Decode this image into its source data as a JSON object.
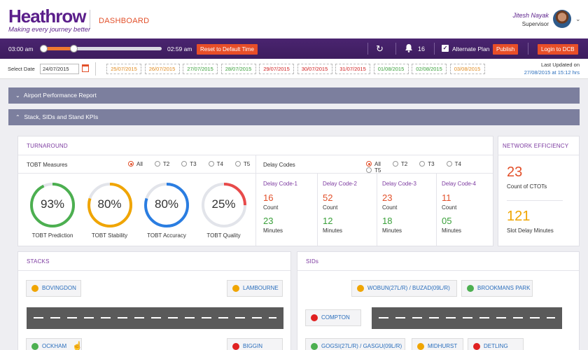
{
  "header": {
    "logo": "Heathrow",
    "tagline": "Making every journey better",
    "section": "DASHBOARD",
    "user_name": "Jitesh Nayak",
    "user_role": "Supervisor"
  },
  "timebar": {
    "start": "03:00 am",
    "end": "02:59 am",
    "reset_label": "Reset to Default Time",
    "notification_count": "16",
    "alternate_plan_label": "Alternate Plan",
    "alternate_plan_checked": true,
    "publish_label": "Publish",
    "login_label": "Login to DCB"
  },
  "daterow": {
    "select_label": "Select Date",
    "date_value": "24/07/2015",
    "dates": [
      {
        "label": "25/07/2015",
        "color": "#e08a1e"
      },
      {
        "label": "26/07/2015",
        "color": "#e08a1e"
      },
      {
        "label": "27/07/2015",
        "color": "#3aa03a"
      },
      {
        "label": "28/07/2015",
        "color": "#3aa03a"
      },
      {
        "label": "29/07/2015",
        "color": "#d02020"
      },
      {
        "label": "30/07/2015",
        "color": "#d02020"
      },
      {
        "label": "31/07/2015",
        "color": "#d02020"
      },
      {
        "label": "01/08/2015",
        "color": "#3aa03a"
      },
      {
        "label": "02/08/2015",
        "color": "#3aa03a"
      },
      {
        "label": "03/08/2015",
        "color": "#e08a1e"
      }
    ],
    "last_updated_label": "Last Updated on",
    "last_updated_value": "27/08/2015 at 15:12 hrs"
  },
  "sections": {
    "airport_report": "Airport Performance Report",
    "stack_sids": "Stack, SIDs and Stand KPIs"
  },
  "turnaround": {
    "title": "TURNAROUND",
    "tobt_label": "TOBT Measures",
    "delay_label": "Delay Codes",
    "filters": [
      "All",
      "T2",
      "T3",
      "T4",
      "T5"
    ],
    "gauges": [
      {
        "value": "93%",
        "label": "TOBT Prediction",
        "pct": 0.93,
        "color": "#4caf50"
      },
      {
        "value": "80%",
        "label": "TOBT Stability",
        "pct": 0.8,
        "color": "#f0a500"
      },
      {
        "value": "80%",
        "label": "TOBT Accuracy",
        "pct": 0.8,
        "color": "#2a7de1"
      },
      {
        "value": "25%",
        "label": "TOBT Quality",
        "pct": 0.25,
        "color": "#e84a4a"
      }
    ],
    "delay_codes": [
      {
        "title": "Delay Code-1",
        "count": "16",
        "minutes": "23"
      },
      {
        "title": "Delay Code-2",
        "count": "52",
        "minutes": "12"
      },
      {
        "title": "Delay Code-3",
        "count": "23",
        "minutes": "18"
      },
      {
        "title": "Delay Code-4",
        "count": "11",
        "minutes": "05"
      }
    ],
    "count_label": "Count",
    "minutes_label": "Minutes",
    "count_color": "#e2502a",
    "minutes_color": "#3aa03a"
  },
  "network": {
    "title": "NETWORK EFFICIENCY",
    "ctot_value": "23",
    "ctot_label": "Count of CTOTs",
    "slot_value": "121",
    "slot_label": "Slot Delay Minutes"
  },
  "stacks": {
    "title": "STACKS",
    "items": [
      {
        "label": "BOVINGDON",
        "status": "#f0a500"
      },
      {
        "label": "LAMBOURNE",
        "status": "#f0a500"
      },
      {
        "label": "OCKHAM",
        "status": "#4caf50"
      },
      {
        "label": "BIGGIN",
        "status": "#e02020"
      }
    ]
  },
  "sids": {
    "title": "SIDs",
    "items": [
      {
        "label": "WOBUN(27L/R) / BUZAD(09L/R)",
        "status": "#f0a500"
      },
      {
        "label": "BROOKMANS PARK",
        "status": "#4caf50"
      },
      {
        "label": "COMPTON",
        "status": "#e02020"
      },
      {
        "label": "GOGSI(27L/R) / GASGU(09L/R)",
        "status": "#4caf50"
      },
      {
        "label": "MIDHURST",
        "status": "#f0a500"
      },
      {
        "label": "DETLING",
        "status": "#e02020"
      }
    ]
  }
}
